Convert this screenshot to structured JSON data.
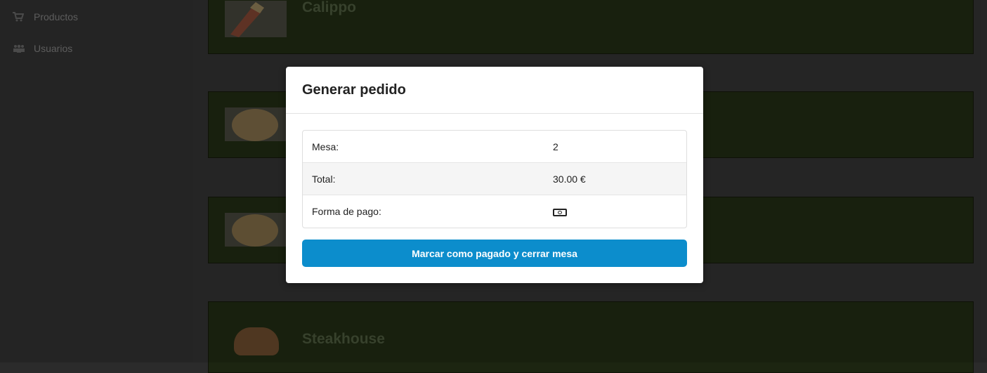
{
  "sidebar": {
    "items": [
      {
        "label": "Productos",
        "icon": "cart-icon"
      },
      {
        "label": "Usuarios",
        "icon": "users-icon"
      }
    ]
  },
  "products": [
    {
      "name": "Calippo"
    },
    {
      "name": ""
    },
    {
      "name": ""
    },
    {
      "name": "Steakhouse"
    }
  ],
  "modal": {
    "title": "Generar pedido",
    "rows": [
      {
        "label": "Mesa:",
        "value": "2"
      },
      {
        "label": "Total:",
        "value": "30.00 €"
      },
      {
        "label": "Forma de pago:",
        "value_icon": "cash-icon"
      }
    ],
    "button_label": "Marcar como pagado y cerrar mesa"
  },
  "colors": {
    "button": "#0c8dcc",
    "card_bg": "#1c2511"
  }
}
